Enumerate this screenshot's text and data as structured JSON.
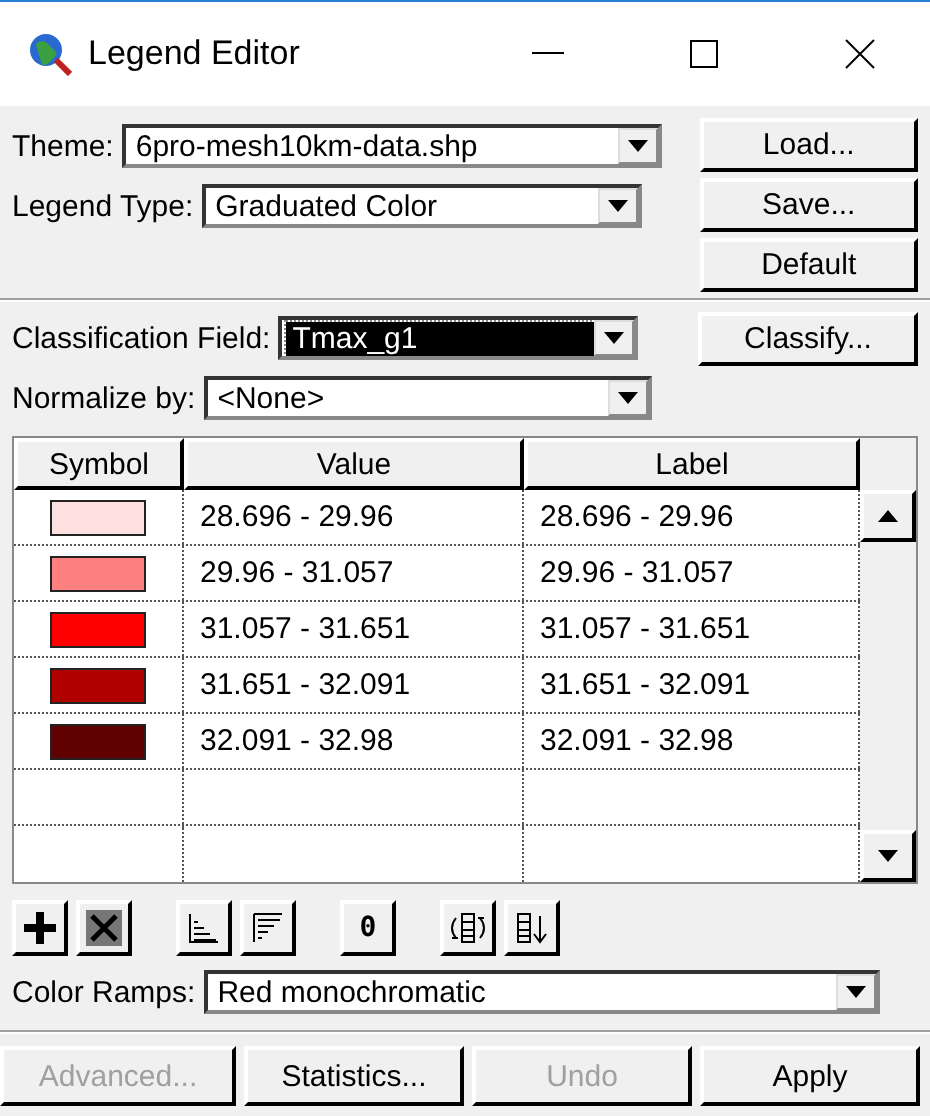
{
  "window": {
    "title": "Legend Editor"
  },
  "theme": {
    "label": "Theme:",
    "value": "6pro-mesh10km-data.shp"
  },
  "legend_type": {
    "label": "Legend Type:",
    "value": "Graduated Color"
  },
  "side_buttons": [
    "Load...",
    "Save...",
    "Default"
  ],
  "classification_field": {
    "label": "Classification Field:",
    "value": "Tmax_g1",
    "focused": true
  },
  "classify_button": "Classify...",
  "normalize_by": {
    "label": "Normalize by:",
    "value": "<None>"
  },
  "table": {
    "columns": [
      "Symbol",
      "Value",
      "Label"
    ],
    "rows": [
      {
        "color": "#ffe0e0",
        "value": "28.696 - 29.96",
        "label": "28.696 - 29.96"
      },
      {
        "color": "#ff8080",
        "value": "29.96 - 31.057",
        "label": "29.96 - 31.057"
      },
      {
        "color": "#ff0000",
        "value": "31.057 - 31.651",
        "label": "31.057 - 31.651"
      },
      {
        "color": "#b00000",
        "value": "31.651 - 32.091",
        "label": "31.651 - 32.091"
      },
      {
        "color": "#600000",
        "value": "32.091 - 32.98",
        "label": "32.091 - 32.98"
      }
    ]
  },
  "tools": [
    {
      "kind": "add"
    },
    {
      "kind": "delete"
    },
    {
      "kind": "ascending"
    },
    {
      "kind": "descending"
    },
    {
      "kind": "text",
      "text": "0"
    },
    {
      "kind": "reverse"
    },
    {
      "kind": "sort"
    }
  ],
  "color_ramps": {
    "label": "Color Ramps:",
    "value": "Red monochromatic"
  },
  "bottom_buttons": [
    {
      "label": "Advanced...",
      "disabled": true
    },
    {
      "label": "Statistics...",
      "disabled": false
    },
    {
      "label": "Undo",
      "disabled": true
    },
    {
      "label": "Apply",
      "disabled": false
    }
  ]
}
